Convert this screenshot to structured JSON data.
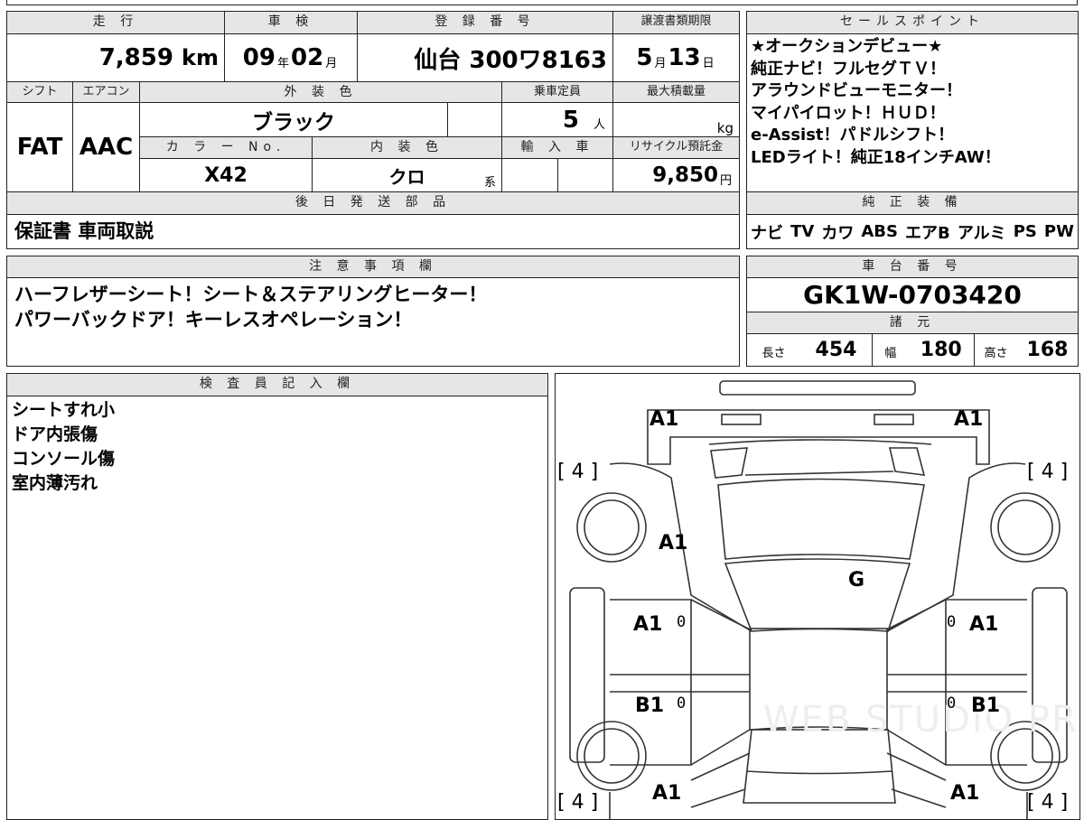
{
  "header_labels": {
    "mileage": "走 行",
    "inspection": "車 検",
    "registration": "登 録 番 号",
    "transfer_deadline": "譲渡書類期限",
    "shift": "シフト",
    "aircon": "エアコン",
    "exterior_color": "外 装 色",
    "capacity": "乗車定員",
    "max_load": "最大積載量",
    "color_no": "カ ラ ー No.",
    "interior_color": "内 装 色",
    "import": "輸 入 車",
    "recycle": "リサイクル預託金",
    "later_parts": "後 日 発 送 部 品",
    "sales_points": "セールスポイント",
    "genuine_equipment": "純 正 装 備",
    "notes": "注 意 事 項 欄",
    "chassis_no": "車 台 番 号",
    "specs": "諸 元",
    "inspector": "検 査 員 記 入 欄"
  },
  "values": {
    "mileage": "7,859",
    "mileage_unit": "km",
    "inspection_year": "09",
    "year_unit": "年",
    "inspection_month": "02",
    "month_unit": "月",
    "registration": "仙台 300ワ8163",
    "deadline_month": "5",
    "deadline_day": "13",
    "day_unit": "日",
    "shift": "FAT",
    "aircon": "AAC",
    "exterior_color": "ブラック",
    "capacity": "5",
    "capacity_unit": "人",
    "max_load_unit": "kg",
    "color_no": "X42",
    "interior_color": "クロ",
    "interior_suffix": "系",
    "recycle": "9,850",
    "recycle_unit": "円",
    "later_parts": "保証書 車両取説"
  },
  "sales_points": [
    "★オークションデビュー★",
    "純正ナビ！フルセグＴＶ！",
    "アラウンドビューモニター！",
    "マイパイロット！ＨＵＤ！",
    "e-Assist！パドルシフト！",
    "LEDライト！純正18インチAW！"
  ],
  "genuine_equipment": [
    "ナビ",
    "TV",
    "カワ",
    "ABS",
    "エアB",
    "アルミ",
    "PS",
    "PW"
  ],
  "notes": [
    "ハーフレザーシート！シート＆ステアリングヒーター！",
    "パワーバックドア！キーレスオペレーション！"
  ],
  "chassis_no": "GK1W-0703420",
  "specs": {
    "length_label": "長さ",
    "length": "454",
    "width_label": "幅",
    "width": "180",
    "height_label": "高さ",
    "height": "168"
  },
  "inspector_notes": [
    "シートすれ小",
    "ドア内張傷",
    "コンソール傷",
    "室内薄汚れ"
  ],
  "diagram": {
    "front_left": "A1",
    "front_right": "A1",
    "tire_fl": "[ 4 ]",
    "tire_fr": "[ 4 ]",
    "tire_rl": "[ 4 ]",
    "tire_rr": "[ 4 ]",
    "fender_l": "A1",
    "windshield": "G",
    "door_fl": "A1",
    "door_fr": "A1",
    "door_rl": "B1",
    "door_rr": "B1",
    "mark_fl": "0",
    "mark_fr": "0",
    "mark_rl": "0",
    "mark_rr": "0",
    "rear_l": "A1",
    "rear_r": "A1",
    "watermark": "WEB STUDIO PRO"
  }
}
